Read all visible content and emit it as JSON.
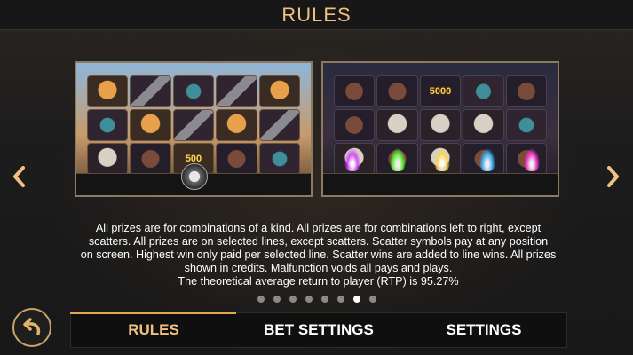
{
  "header": {
    "title": "RULES"
  },
  "screenshots": [
    {
      "highlight_value": "500"
    },
    {
      "highlight_value": "5000"
    }
  ],
  "rules_text": [
    "All prizes are for combinations of a kind. All prizes are for combinations left to right, except",
    "scatters. All prizes are on selected lines, except scatters. Scatter symbols pay at any position",
    "on screen. Highest win only paid per selected line. Scatter wins are added to line wins. All prizes",
    "shown in credits. Malfunction voids all pays and plays.",
    "The theoretical average return to player (RTP) is 95.27%"
  ],
  "pagination": {
    "total": 8,
    "active_index": 6
  },
  "tabs": [
    {
      "label": "RULES",
      "active": true
    },
    {
      "label": "BET SETTINGS",
      "active": false
    },
    {
      "label": "SETTINGS",
      "active": false
    }
  ],
  "icons": {
    "prev": "chevron-left-icon",
    "next": "chevron-right-icon",
    "back": "undo-arrow-icon"
  },
  "colors": {
    "accent": "#f0c080",
    "tab_indicator": "#e0a64f",
    "flames": [
      "#d23cff",
      "#5aff3a",
      "#ffd24a",
      "#35b8ff",
      "#ff3ad8"
    ]
  }
}
